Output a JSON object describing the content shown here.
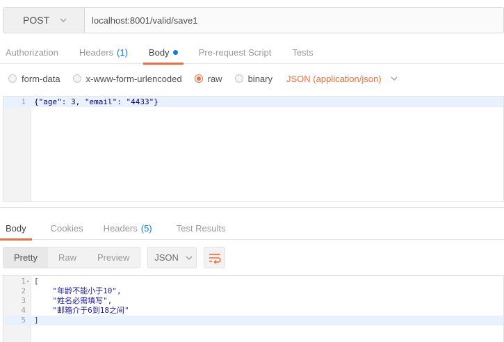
{
  "request": {
    "method": "POST",
    "url": "localhost:8001/valid/save1"
  },
  "request_tabs": [
    {
      "label": "Authorization"
    },
    {
      "label": "Headers",
      "count": "(1)"
    },
    {
      "label": "Body",
      "active": true,
      "modified_dot": true
    },
    {
      "label": "Pre-request Script"
    },
    {
      "label": "Tests"
    }
  ],
  "body_types": [
    {
      "label": "form-data"
    },
    {
      "label": "x-www-form-urlencoded"
    },
    {
      "label": "raw",
      "selected": true
    },
    {
      "label": "binary"
    }
  ],
  "content_type": "JSON (application/json)",
  "request_body": {
    "line_numbers": [
      "1"
    ],
    "lines": [
      "{\"age\": 3, \"email\": \"4433\"}"
    ]
  },
  "response_tabs": [
    {
      "label": "Body",
      "active": true
    },
    {
      "label": "Cookies"
    },
    {
      "label": "Headers",
      "count": "(5)"
    },
    {
      "label": "Test Results"
    }
  ],
  "response_view": {
    "modes": [
      "Pretty",
      "Raw",
      "Preview"
    ],
    "active_mode": "Pretty",
    "format": "JSON"
  },
  "response_body": {
    "line_numbers": [
      "1",
      "2",
      "3",
      "4",
      "5"
    ],
    "lines": [
      "[",
      "    \"年龄不能小于10\",",
      "    \"姓名必需填写\",",
      "    \"邮箱介于6到18之间\"",
      "]"
    ]
  },
  "colors": {
    "accent": "#f26b3a",
    "link_blue": "#097bed",
    "string_blue": "#1a1aa6",
    "active_line": "#e8f2fe"
  },
  "icons": {
    "method_dropdown": "chevron-down-icon",
    "content_type_dropdown": "chevron-down-icon",
    "format_dropdown": "chevron-down-icon",
    "wrap_lines": "wrap-lines-icon"
  }
}
